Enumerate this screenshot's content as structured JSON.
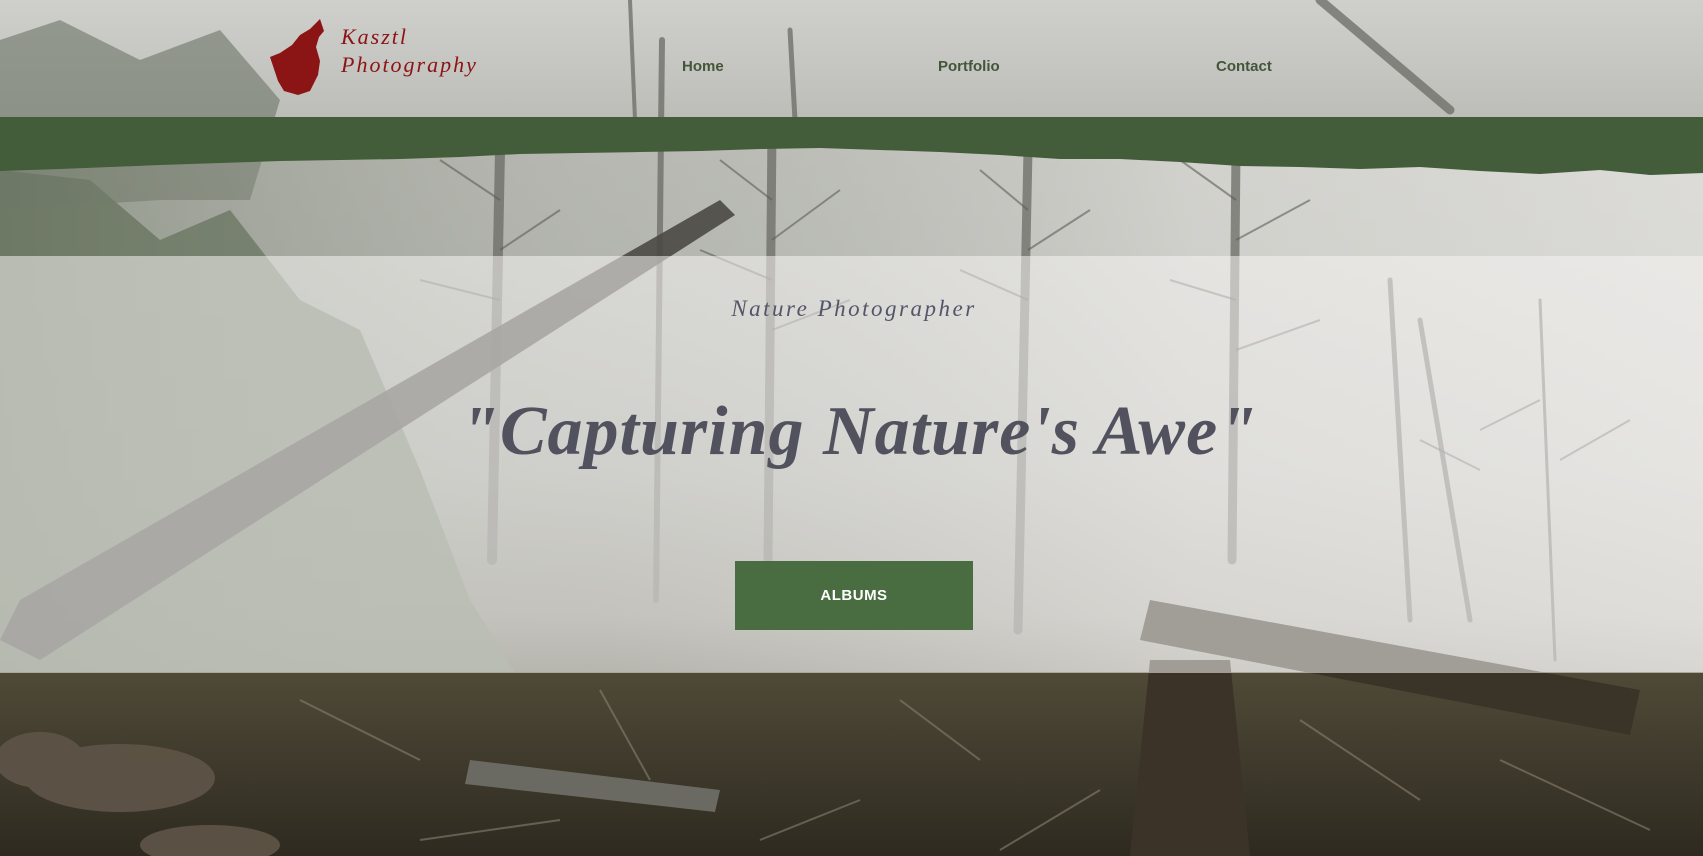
{
  "brand": {
    "line1": "Kasztl",
    "line2": "Photography",
    "logo_icon": "wolf-howling-icon",
    "color": "#8b1414"
  },
  "nav": {
    "items": [
      {
        "label": "Home"
      },
      {
        "label": "Portfolio"
      },
      {
        "label": "Contact"
      }
    ],
    "color": "#44563a"
  },
  "hero": {
    "subtitle": "Nature Photographer",
    "headline": "\"Capturing Nature's Awe\"",
    "button_label": "ALBUMS"
  },
  "colors": {
    "band_green": "#435c3a",
    "button_green": "#4a6c41",
    "text_gray": "#52525f"
  }
}
